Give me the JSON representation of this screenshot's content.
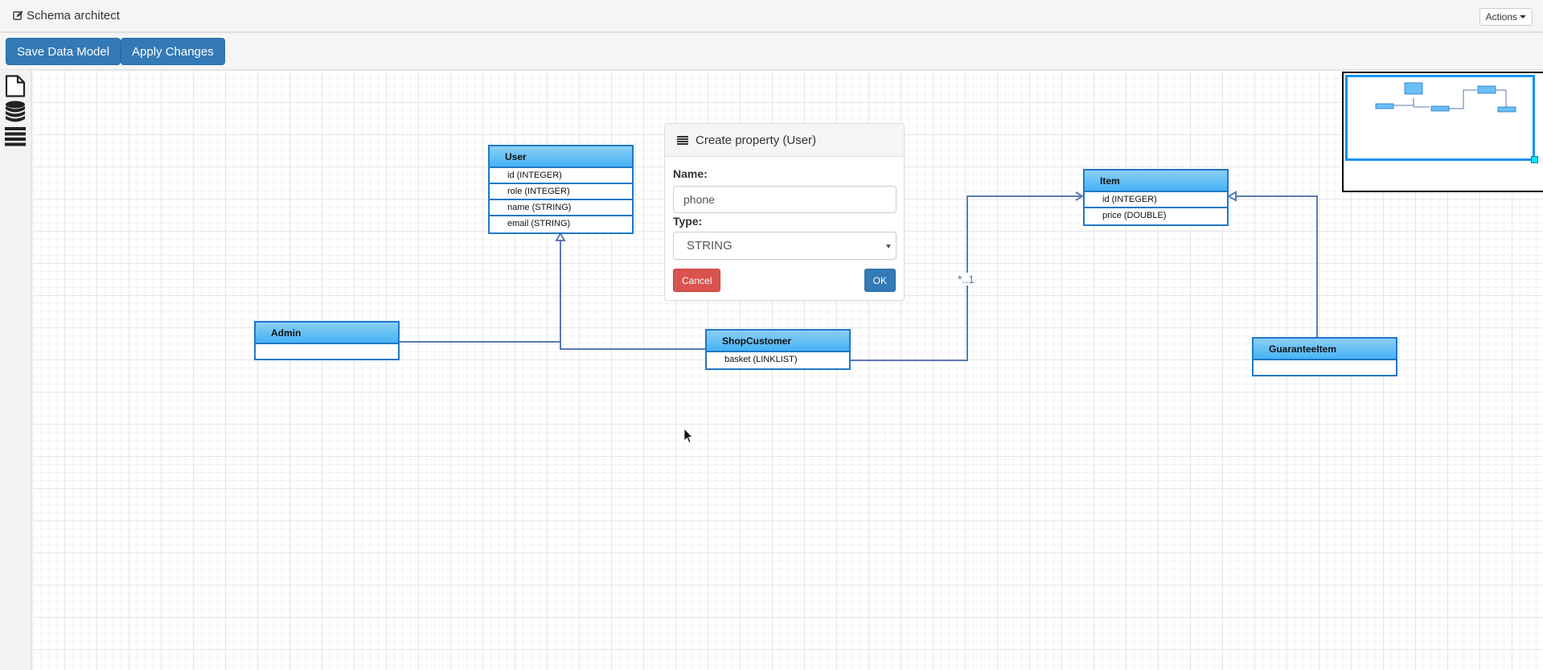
{
  "header": {
    "title": "Schema architect",
    "title_icon": "edit-icon",
    "actions_label": "Actions"
  },
  "toolbar": {
    "save_label": "Save Data Model",
    "apply_label": "Apply Changes"
  },
  "sidebar": {
    "tools": [
      {
        "name": "new-document",
        "icon": "file-icon"
      },
      {
        "name": "database",
        "icon": "database-icon"
      },
      {
        "name": "list",
        "icon": "list-icon"
      }
    ]
  },
  "entities": {
    "user": {
      "name": "User",
      "properties": [
        "id (INTEGER)",
        "role (INTEGER)",
        "name (STRING)",
        "email (STRING)"
      ]
    },
    "admin": {
      "name": "Admin",
      "properties": []
    },
    "shop_customer": {
      "name": "ShopCustomer",
      "properties": [
        "basket (LINKLIST)"
      ]
    },
    "item": {
      "name": "Item",
      "properties": [
        "id (INTEGER)",
        "price (DOUBLE)"
      ]
    },
    "guarantee_item": {
      "name": "GuaranteeItem",
      "properties": []
    }
  },
  "relations": [
    {
      "from": "Admin",
      "to": "User",
      "kind": "inheritance"
    },
    {
      "from": "ShopCustomer",
      "to": "User",
      "kind": "inheritance"
    },
    {
      "from": "ShopCustomer",
      "to": "Item",
      "kind": "association",
      "multiplicity": "*..1"
    },
    {
      "from": "GuaranteeItem",
      "to": "Item",
      "kind": "inheritance"
    }
  ],
  "dialog": {
    "title": "Create property (User)",
    "title_icon": "list-icon",
    "name_label": "Name:",
    "name_value": "phone",
    "type_label": "Type:",
    "type_value": "STRING",
    "cancel_label": "Cancel",
    "ok_label": "OK"
  },
  "colors": {
    "primary": "#337ab7",
    "danger": "#d9534f",
    "entity_border": "#1f78c8",
    "link": "#5b7ab3",
    "minimap_viewport": "#1793f3"
  }
}
